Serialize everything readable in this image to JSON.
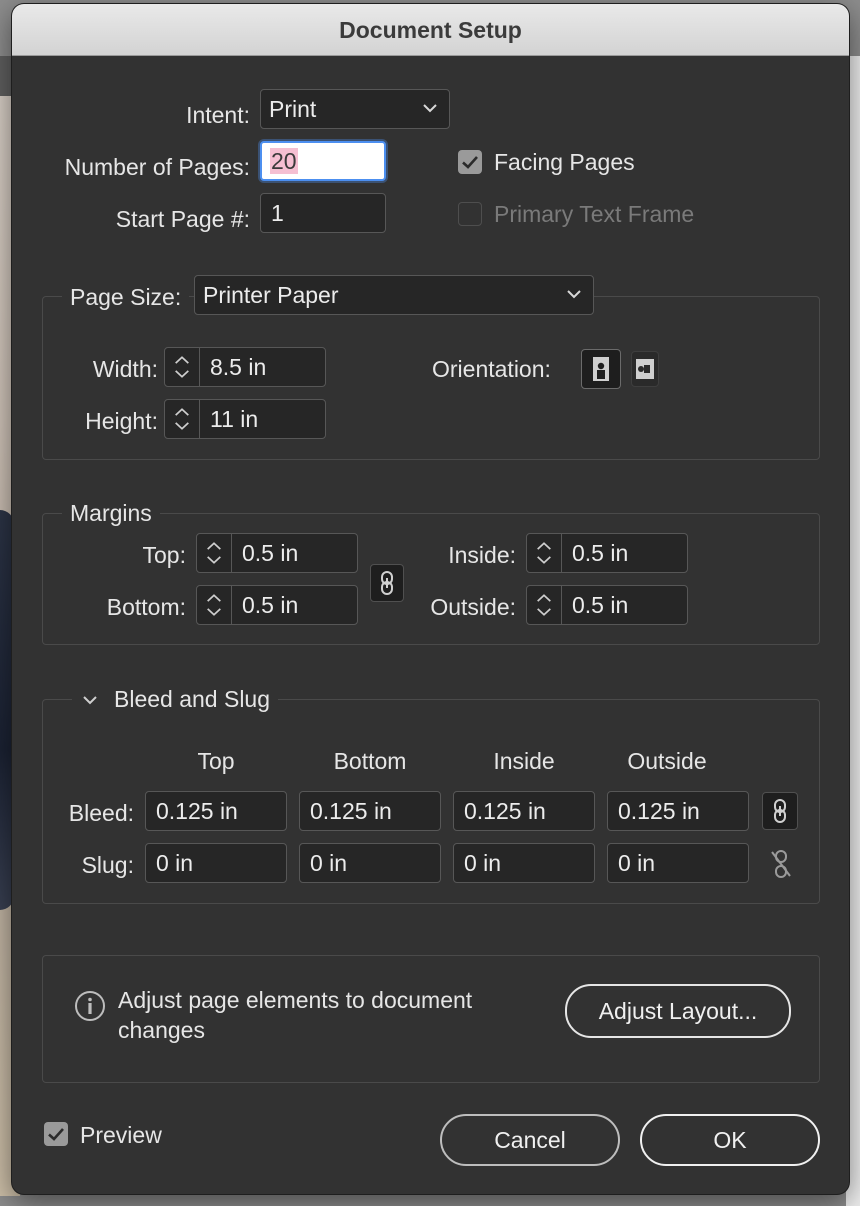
{
  "window": {
    "title": "Document Setup"
  },
  "document": {
    "intent_label": "Intent:",
    "intent_value": "Print",
    "pages_label": "Number of Pages:",
    "pages_value": "20",
    "start_label": "Start Page #:",
    "start_value": "1",
    "facing_label": "Facing Pages",
    "facing_checked": true,
    "primary_label": "Primary Text Frame",
    "primary_checked": false
  },
  "page_size": {
    "label": "Page Size:",
    "value": "Printer Paper",
    "width_label": "Width:",
    "width_value": "8.5 in",
    "height_label": "Height:",
    "height_value": "11 in",
    "orientation_label": "Orientation:",
    "orientation_selected": "portrait"
  },
  "margins": {
    "title": "Margins",
    "top_label": "Top:",
    "top_value": "0.5 in",
    "bottom_label": "Bottom:",
    "bottom_value": "0.5 in",
    "inside_label": "Inside:",
    "inside_value": "0.5 in",
    "outside_label": "Outside:",
    "outside_value": "0.5 in",
    "linked": true
  },
  "bleed_slug": {
    "title": "Bleed and Slug",
    "expanded": true,
    "columns": [
      "Top",
      "Bottom",
      "Inside",
      "Outside"
    ],
    "bleed_label": "Bleed:",
    "bleed_values": [
      "0.125 in",
      "0.125 in",
      "0.125 in",
      "0.125 in"
    ],
    "bleed_linked": true,
    "slug_label": "Slug:",
    "slug_values": [
      "0 in",
      "0 in",
      "0 in",
      "0 in"
    ],
    "slug_linked": false
  },
  "adjust": {
    "text_line1": "Adjust page elements to document",
    "text_line2": "changes",
    "button_label": "Adjust Layout..."
  },
  "footer": {
    "preview_label": "Preview",
    "preview_checked": true,
    "cancel_label": "Cancel",
    "ok_label": "OK"
  },
  "colors": {
    "dialog_bg": "#323232",
    "field_bg": "#262626",
    "focus_ring": "#4c8ff0",
    "selection": "#f5bfd2"
  }
}
